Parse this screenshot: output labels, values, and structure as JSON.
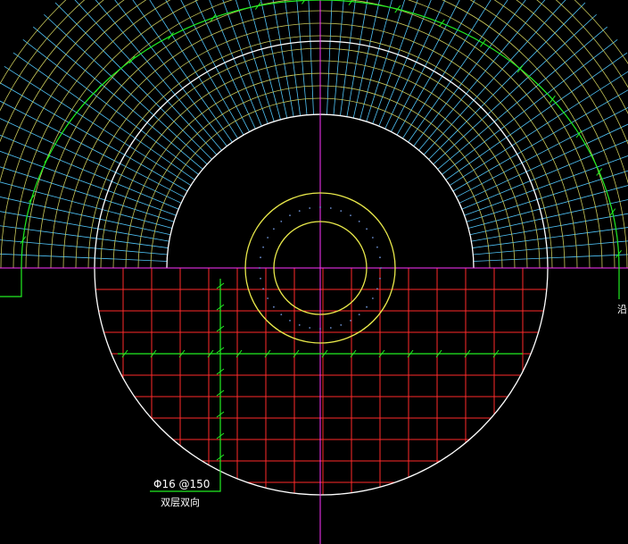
{
  "drawing": {
    "background_color": "#000000",
    "colors": {
      "outline": "#ffffff",
      "rebar_grid": "#ff2a2a",
      "radial_lines": "#4fc3f7",
      "ring_lines": "#c9c95a",
      "annotation": "#22ee22",
      "pipe": "#e8e84a",
      "axis": "#ff33ff"
    },
    "labels": {
      "rebar_spec": "Φ16 @150",
      "rebar_direction": "双层双向",
      "edge_fragment": "沿"
    }
  }
}
